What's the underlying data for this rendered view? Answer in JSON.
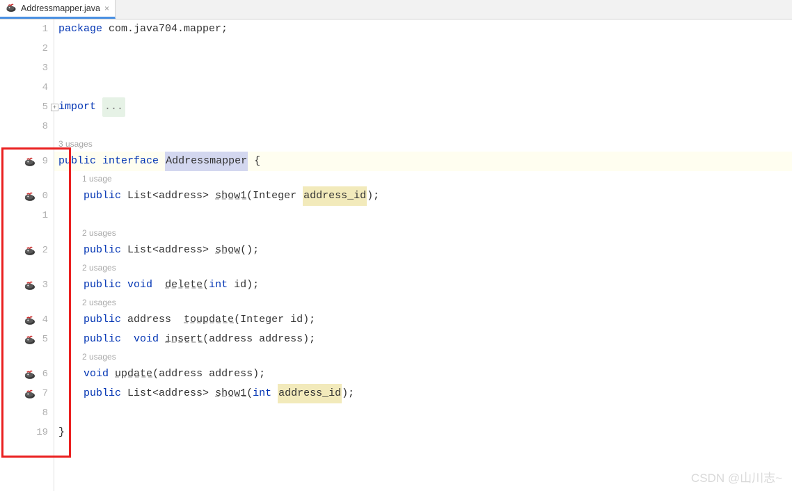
{
  "tab": {
    "filename": "Addressmapper.java"
  },
  "watermark": "CSDN @山川志~",
  "usages": {
    "u3": "3 usages",
    "u1": "1 usage",
    "u2": "2 usages"
  },
  "lines": {
    "l1": {
      "num": "1",
      "kw": "package",
      "rest": " com.java704.mapper;"
    },
    "l2": {
      "num": "2"
    },
    "l3": {
      "num": "3"
    },
    "l4": {
      "num": "4"
    },
    "l5": {
      "num": "5",
      "kw": "import",
      "folded": "..."
    },
    "l8": {
      "num": "8"
    },
    "l9": {
      "num": "9",
      "kw1": "public",
      "kw2": "interface",
      "cls": "Addressmapper",
      "brace": " {"
    },
    "l10": {
      "num": "0",
      "kw": "public",
      "type": " List<address> ",
      "method": "show1",
      "p1": "(Integer ",
      "param": "address_id",
      "p2": ");"
    },
    "l11": {
      "num": "1"
    },
    "l12": {
      "num": "2",
      "kw": "public",
      "type": " List<address> ",
      "method": "show",
      "rest": "();"
    },
    "l13": {
      "num": "3",
      "kw1": "public",
      "kw2": "void",
      "sp": "  ",
      "method": "delete",
      "p1": "(",
      "kw3": "int",
      "rest": " id);"
    },
    "l14": {
      "num": "4",
      "kw": "public",
      "type": " address  ",
      "method": "toupdate",
      "rest": "(Integer id);"
    },
    "l15": {
      "num": "5",
      "kw1": "public",
      "sp": "  ",
      "kw2": "void",
      "method": "insert",
      "rest": "(address address);"
    },
    "l16": {
      "num": "6",
      "kw": "void",
      "method": "update",
      "rest": "(address address);"
    },
    "l17": {
      "num": "7",
      "kw": "public",
      "type": " List<address> ",
      "method": "show1",
      "p1": "(",
      "kw2": "int",
      "sp": " ",
      "param": "address_id",
      "p2": ");"
    },
    "l18": {
      "num": "8"
    },
    "l19": {
      "num": "19",
      "brace": "}"
    }
  }
}
